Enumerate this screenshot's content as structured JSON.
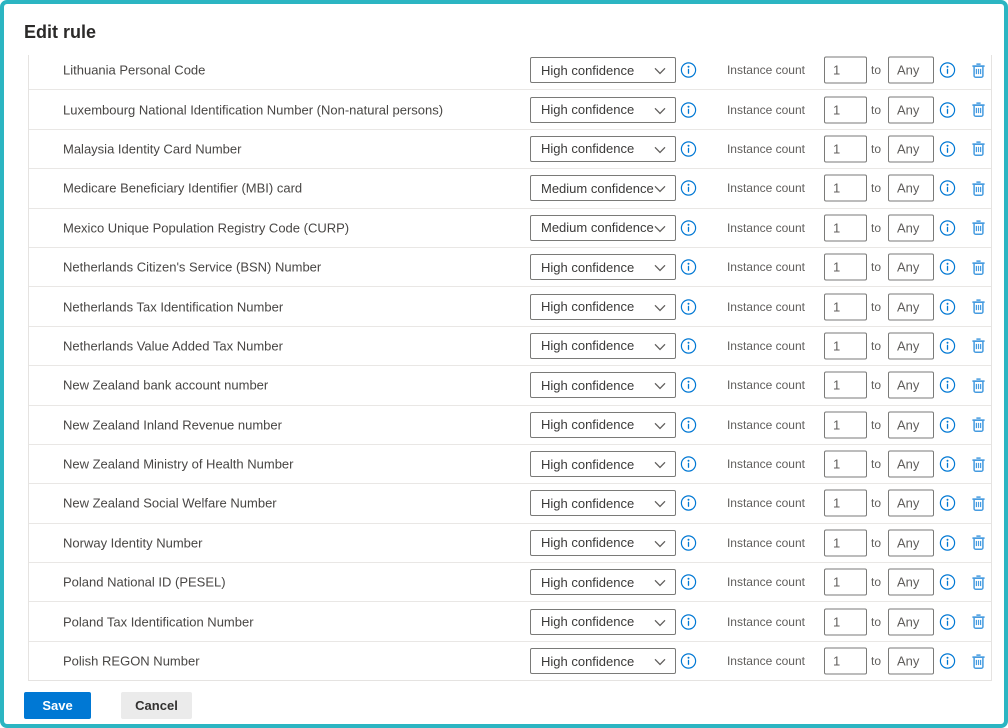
{
  "title": "Edit rule",
  "labels": {
    "instance_count": "Instance count",
    "to": "to"
  },
  "icons": {
    "dropdown_chevron": "chevron-down-icon",
    "confidence_info": "info-icon",
    "instance_info": "info-icon",
    "delete": "trash-icon"
  },
  "colors": {
    "window_border": "#2bb5c2",
    "primary_button": "#0078d4",
    "info_icon_blue": "#0078d4",
    "trash_icon_blue": "#459be0",
    "divider": "#e9e7e5",
    "control_border": "#7a7a78"
  },
  "rules": [
    {
      "name": "Lithuania Personal Code",
      "confidence": "High confidence",
      "min": "1",
      "max": "Any"
    },
    {
      "name": "Luxembourg National Identification Number (Non-natural persons)",
      "confidence": "High confidence",
      "min": "1",
      "max": "Any"
    },
    {
      "name": "Malaysia Identity Card Number",
      "confidence": "High confidence",
      "min": "1",
      "max": "Any"
    },
    {
      "name": "Medicare Beneficiary Identifier (MBI) card",
      "confidence": "Medium confidence",
      "min": "1",
      "max": "Any"
    },
    {
      "name": "Mexico Unique Population Registry Code (CURP)",
      "confidence": "Medium confidence",
      "min": "1",
      "max": "Any"
    },
    {
      "name": "Netherlands Citizen's Service (BSN) Number",
      "confidence": "High confidence",
      "min": "1",
      "max": "Any"
    },
    {
      "name": "Netherlands Tax Identification Number",
      "confidence": "High confidence",
      "min": "1",
      "max": "Any"
    },
    {
      "name": "Netherlands Value Added Tax Number",
      "confidence": "High confidence",
      "min": "1",
      "max": "Any"
    },
    {
      "name": "New Zealand bank account number",
      "confidence": "High confidence",
      "min": "1",
      "max": "Any"
    },
    {
      "name": "New Zealand Inland Revenue number",
      "confidence": "High confidence",
      "min": "1",
      "max": "Any"
    },
    {
      "name": "New Zealand Ministry of Health Number",
      "confidence": "High confidence",
      "min": "1",
      "max": "Any"
    },
    {
      "name": "New Zealand Social Welfare Number",
      "confidence": "High confidence",
      "min": "1",
      "max": "Any"
    },
    {
      "name": "Norway Identity Number",
      "confidence": "High confidence",
      "min": "1",
      "max": "Any"
    },
    {
      "name": "Poland National ID (PESEL)",
      "confidence": "High confidence",
      "min": "1",
      "max": "Any"
    },
    {
      "name": "Poland Tax Identification Number",
      "confidence": "High confidence",
      "min": "1",
      "max": "Any"
    },
    {
      "name": "Polish REGON Number",
      "confidence": "High confidence",
      "min": "1",
      "max": "Any"
    }
  ],
  "footer": {
    "save": "Save",
    "cancel": "Cancel"
  }
}
